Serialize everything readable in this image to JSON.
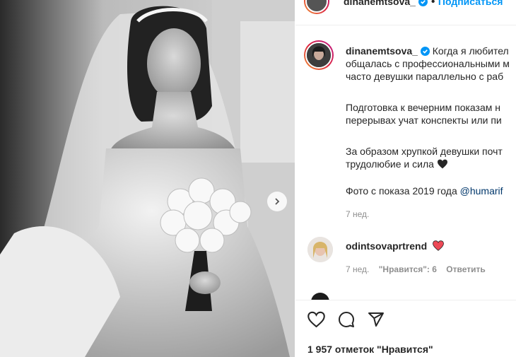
{
  "post": {
    "author": "dinanemtsova_",
    "follow_label": "Подписаться",
    "caption_lines": [
      "Когда я любител",
      "общалась с профессиональными м",
      "часто девушки параллельно с раб",
      "Подготовка к вечерним показам н",
      "перерывах учат конспекты или пи",
      "За образом хрупкой девушки почт",
      "трудолюбие и сила"
    ],
    "caption_photo_prefix": "Фото с показа 2019 года ",
    "caption_mention": "@humarif",
    "caption_time": "7 нед."
  },
  "comment": {
    "author": "odintsovaprtrend",
    "time": "7 нед.",
    "likes": "\"Нравится\": 6",
    "reply_label": "Ответить"
  },
  "footer": {
    "likes_text": "1 957 отметок \"Нравится\""
  },
  "icons": {
    "verified": "verified-badge-icon",
    "heart_red": "#ed4956",
    "accent": "#0095f6"
  }
}
